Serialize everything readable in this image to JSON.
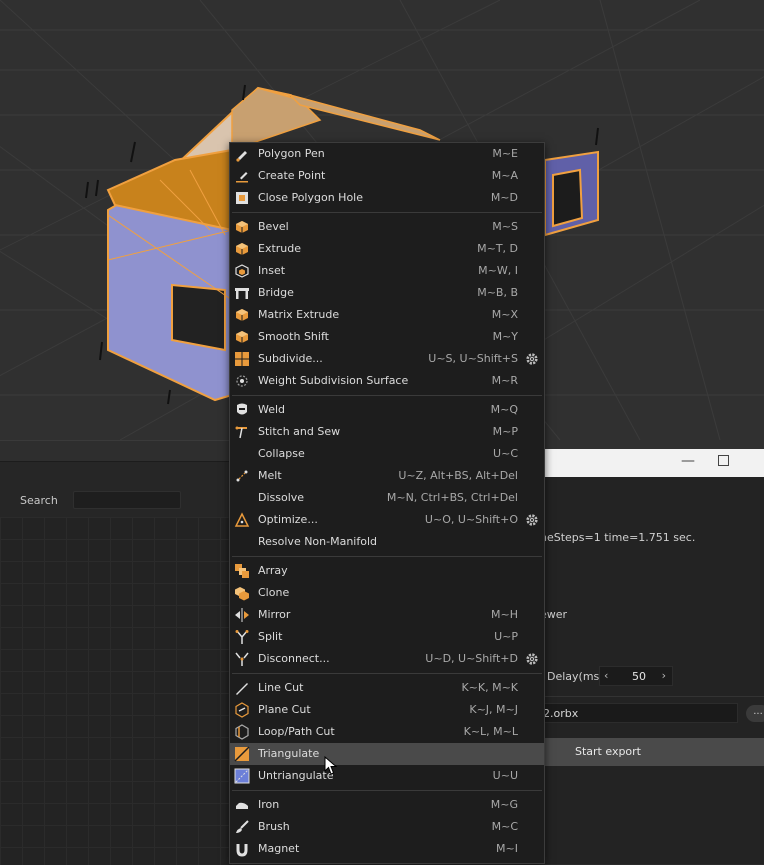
{
  "left_panel": {
    "search_label": "Search",
    "search_value": ""
  },
  "export_dialog": {
    "minimize_glyph": "—",
    "stats_text": "neSteps=1  time=1.751 sec.",
    "viewer_text": "ewer",
    "delay_label": "Delay(ms.)",
    "delay_value": "50",
    "file_value": "2.orbx",
    "browse_label": "...",
    "export_label": "Start export"
  },
  "menu": {
    "groups": [
      [
        {
          "id": "polygon-pen",
          "label": "Polygon Pen",
          "shortcut": "M~E",
          "icon": "pen-icon"
        },
        {
          "id": "create-point",
          "label": "Create Point",
          "shortcut": "M~A",
          "icon": "pen-point-icon"
        },
        {
          "id": "close-polygon-hole",
          "label": "Close Polygon Hole",
          "shortcut": "M~D",
          "icon": "square-hole-icon"
        }
      ],
      [
        {
          "id": "bevel",
          "label": "Bevel",
          "shortcut": "M~S",
          "icon": "cube-icon"
        },
        {
          "id": "extrude",
          "label": "Extrude",
          "shortcut": "M~T, D",
          "icon": "cube-icon"
        },
        {
          "id": "inset",
          "label": "Inset",
          "shortcut": "M~W, I",
          "icon": "inset-cube-icon"
        },
        {
          "id": "bridge",
          "label": "Bridge",
          "shortcut": "M~B, B",
          "icon": "bridge-icon"
        },
        {
          "id": "matrix-extrude",
          "label": "Matrix Extrude",
          "shortcut": "M~X",
          "icon": "cube-icon"
        },
        {
          "id": "smooth-shift",
          "label": "Smooth Shift",
          "shortcut": "M~Y",
          "icon": "cube-icon"
        },
        {
          "id": "subdivide",
          "label": "Subdivide...",
          "shortcut": "U~S, U~Shift+S",
          "icon": "grid-orange-icon",
          "gear": true
        },
        {
          "id": "weight-subdivision-surface",
          "label": "Weight Subdivision Surface",
          "shortcut": "M~R",
          "icon": "weight-icon"
        }
      ],
      [
        {
          "id": "weld",
          "label": "Weld",
          "shortcut": "M~Q",
          "icon": "weld-mask-icon"
        },
        {
          "id": "stitch-and-sew",
          "label": "Stitch and Sew",
          "shortcut": "M~P",
          "icon": "stitch-icon"
        },
        {
          "id": "collapse",
          "label": "Collapse",
          "shortcut": "U~C",
          "icon": ""
        },
        {
          "id": "melt",
          "label": "Melt",
          "shortcut": "U~Z, Alt+BS, Alt+Del",
          "icon": "melt-icon"
        },
        {
          "id": "dissolve",
          "label": "Dissolve",
          "shortcut": "M~N, Ctrl+BS, Ctrl+Del",
          "icon": ""
        },
        {
          "id": "optimize",
          "label": "Optimize...",
          "shortcut": "U~O, U~Shift+O",
          "icon": "triangle-points-icon",
          "gear": true
        },
        {
          "id": "resolve-non-manifold",
          "label": "Resolve Non-Manifold",
          "shortcut": "",
          "icon": ""
        }
      ],
      [
        {
          "id": "array",
          "label": "Array",
          "shortcut": "",
          "icon": "array-icon"
        },
        {
          "id": "clone",
          "label": "Clone",
          "shortcut": "",
          "icon": "clone-icon"
        },
        {
          "id": "mirror",
          "label": "Mirror",
          "shortcut": "M~H",
          "icon": "mirror-icon"
        },
        {
          "id": "split",
          "label": "Split",
          "shortcut": "U~P",
          "icon": "split-icon"
        },
        {
          "id": "disconnect",
          "label": "Disconnect...",
          "shortcut": "U~D, U~Shift+D",
          "icon": "disconnect-icon",
          "gear": true
        }
      ],
      [
        {
          "id": "line-cut",
          "label": "Line Cut",
          "shortcut": "K~K, M~K",
          "icon": "knife-icon"
        },
        {
          "id": "plane-cut",
          "label": "Plane Cut",
          "shortcut": "K~J, M~J",
          "icon": "plane-cut-icon"
        },
        {
          "id": "loop-path-cut",
          "label": "Loop/Path Cut",
          "shortcut": "K~L, M~L",
          "icon": "loop-cut-icon"
        },
        {
          "id": "triangulate",
          "label": "Triangulate",
          "shortcut": "",
          "icon": "triangulate-icon",
          "highlight": true
        },
        {
          "id": "untriangulate",
          "label": "Untriangulate",
          "shortcut": "U~U",
          "icon": "untriangulate-icon"
        }
      ],
      [
        {
          "id": "iron",
          "label": "Iron",
          "shortcut": "M~G",
          "icon": "iron-icon"
        },
        {
          "id": "brush",
          "label": "Brush",
          "shortcut": "M~C",
          "icon": "brush-icon"
        },
        {
          "id": "magnet",
          "label": "Magnet",
          "shortcut": "M~I",
          "icon": "magnet-icon"
        }
      ]
    ]
  }
}
